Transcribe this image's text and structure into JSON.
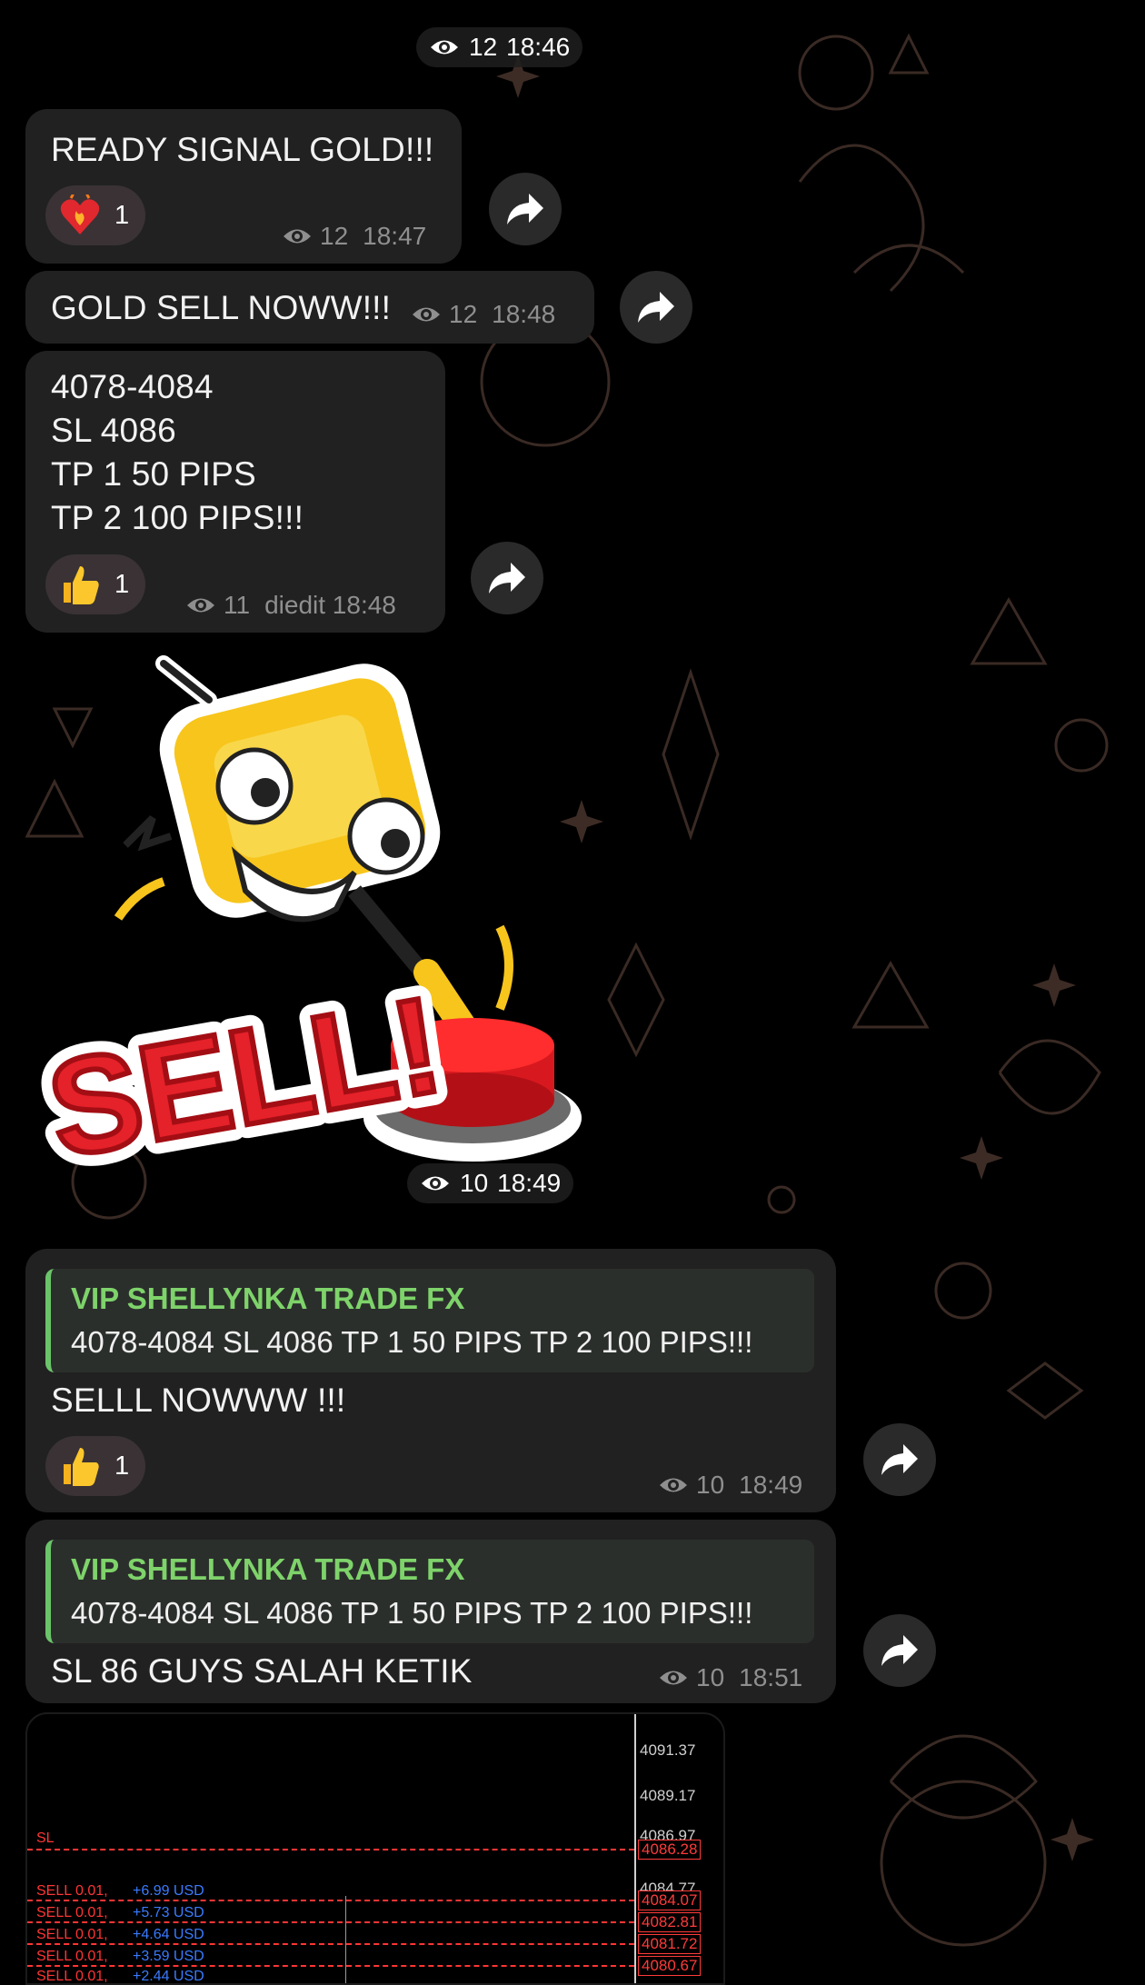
{
  "top_meta": {
    "views": "12",
    "time": "18:46"
  },
  "messages": [
    {
      "text": "READY SIGNAL GOLD!!!",
      "reaction": {
        "emoji": "heart-on-fire",
        "count": "1"
      },
      "views": "12",
      "time": "18:47"
    },
    {
      "text": "GOLD SELL NOWW!!!",
      "views": "12",
      "time": "18:48"
    },
    {
      "lines": [
        "4078-4084",
        "SL 4086",
        "TP 1 50 PIPS",
        "TP 2 100 PIPS!!!"
      ],
      "reaction": {
        "emoji": "thumbs-up",
        "count": "1"
      },
      "views": "11",
      "time": "diedit 18:48"
    },
    {
      "sticker": {
        "label": "SELL!",
        "character": "gold-bar-pressing-red-button"
      },
      "views": "10",
      "time": "18:49"
    },
    {
      "reply": {
        "author": "VIP SHELLYNKA TRADE FX",
        "text": "4078-4084 SL 4086 TP 1 50 PIPS TP 2 100 PIPS!!!"
      },
      "text": "SELLL NOWWW !!!",
      "reaction": {
        "emoji": "thumbs-up",
        "count": "1"
      },
      "views": "10",
      "time": "18:49"
    },
    {
      "reply": {
        "author": "VIP SHELLYNKA TRADE FX",
        "text": "4078-4084 SL 4086 TP 1 50 PIPS TP 2 100 PIPS!!!"
      },
      "text": "SL 86 GUYS SALAH KETIK",
      "views": "10",
      "time": "18:51"
    }
  ],
  "screenshot": {
    "sl_label": "SL",
    "prices": [
      "4091.37",
      "4089.17",
      "4086.97",
      "4084.77"
    ],
    "price_boxes": [
      "4086.28",
      "4084.07",
      "4082.81",
      "4081.72",
      "4080.67"
    ],
    "orders": [
      {
        "label": "SELL 0.01,",
        "value": "+6.99 USD"
      },
      {
        "label": "SELL 0.01,",
        "value": "+5.73 USD"
      },
      {
        "label": "SELL 0.01,",
        "value": "+4.64 USD"
      },
      {
        "label": "SELL 0.01,",
        "value": "+3.59 USD"
      },
      {
        "label": "SELL 0.01,",
        "value": "+2.44 USD"
      }
    ]
  },
  "colors": {
    "bubble": "#212121",
    "reply_accent": "#6cc46a",
    "reply_name": "#7ed36a",
    "meta": "#8f8f8f",
    "loss": "#ff3535",
    "profit": "#3a7bff"
  }
}
